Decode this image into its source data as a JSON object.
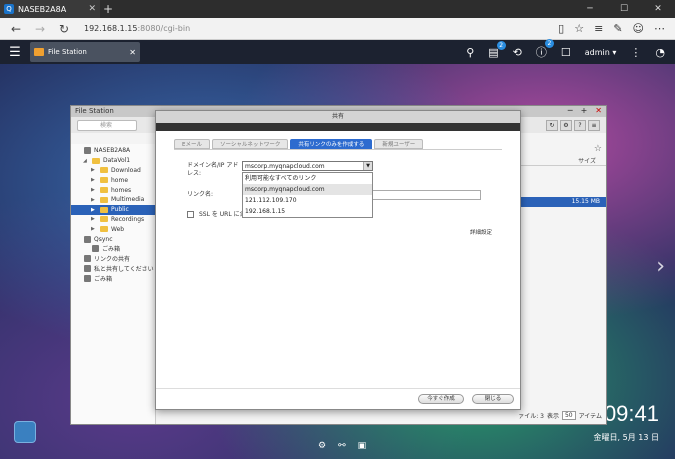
{
  "browser": {
    "tab_title": "NASEB2A8A",
    "favicon": "Q",
    "new_tab": "+",
    "url_host": "192.168.1.15",
    "url_rest": ":8080/cgi-bin"
  },
  "qts": {
    "app_tab_label": "File Station",
    "badge_tasks": "2",
    "badge_notifications": "2",
    "user": "admin ▾"
  },
  "file_station": {
    "title": "File Station",
    "search_placeholder": "検索",
    "tree": [
      {
        "label": "NASEB2A8A",
        "indent": 0,
        "icon": "nas",
        "tri": ""
      },
      {
        "label": "DataVol1",
        "indent": 1,
        "icon": "folder",
        "tri": "◢"
      },
      {
        "label": "Download",
        "indent": 2,
        "icon": "folder",
        "tri": "▶"
      },
      {
        "label": "home",
        "indent": 2,
        "icon": "folder",
        "tri": "▶"
      },
      {
        "label": "homes",
        "indent": 2,
        "icon": "folder",
        "tri": "▶"
      },
      {
        "label": "Multimedia",
        "indent": 2,
        "icon": "folder",
        "tri": "▶"
      },
      {
        "label": "Public",
        "indent": 2,
        "icon": "folder",
        "tri": "▶",
        "selected": true
      },
      {
        "label": "Recordings",
        "indent": 2,
        "icon": "folder",
        "tri": "▶"
      },
      {
        "label": "Web",
        "indent": 2,
        "icon": "folder",
        "tri": "▶"
      },
      {
        "label": "Qsync",
        "indent": 0,
        "icon": "node",
        "tri": ""
      },
      {
        "label": "ごみ箱",
        "indent": 1,
        "icon": "node",
        "tri": ""
      },
      {
        "label": "リンクの共有",
        "indent": 0,
        "icon": "node",
        "tri": ""
      },
      {
        "label": "私と共有してください",
        "indent": 0,
        "icon": "node",
        "tri": ""
      },
      {
        "label": "ごみ箱",
        "indent": 0,
        "icon": "node",
        "tri": ""
      }
    ],
    "col_size": "サイズ",
    "row_size": "15.15 MB",
    "status_prefix": "ァイル: 3",
    "status_show": "表示",
    "status_per_page": "50",
    "status_items": "アイテム"
  },
  "share_dialog": {
    "title": "共有",
    "tabs": [
      "Eメール",
      "ソーシャルネットワーク",
      "共有リンクのみを作成する",
      "新規ユーザー"
    ],
    "domain_label": "ドメイン名/IP アドレス:",
    "domain_value": "mscorp.myqnapcloud.com",
    "link_name_label": "リンク名:",
    "ssl_label": "SSL を URL に含",
    "dropdown_options": [
      "利用可能なすべてのリンク",
      "mscorp.myqnapcloud.com",
      "121.112.109.170",
      "192.168.1.15"
    ],
    "advanced": "詳細設定",
    "create_button": "今すぐ作成",
    "close_button": "閉じる"
  },
  "desktop": {
    "time": "09:41",
    "date": "金曜日, 5月 13 日"
  }
}
